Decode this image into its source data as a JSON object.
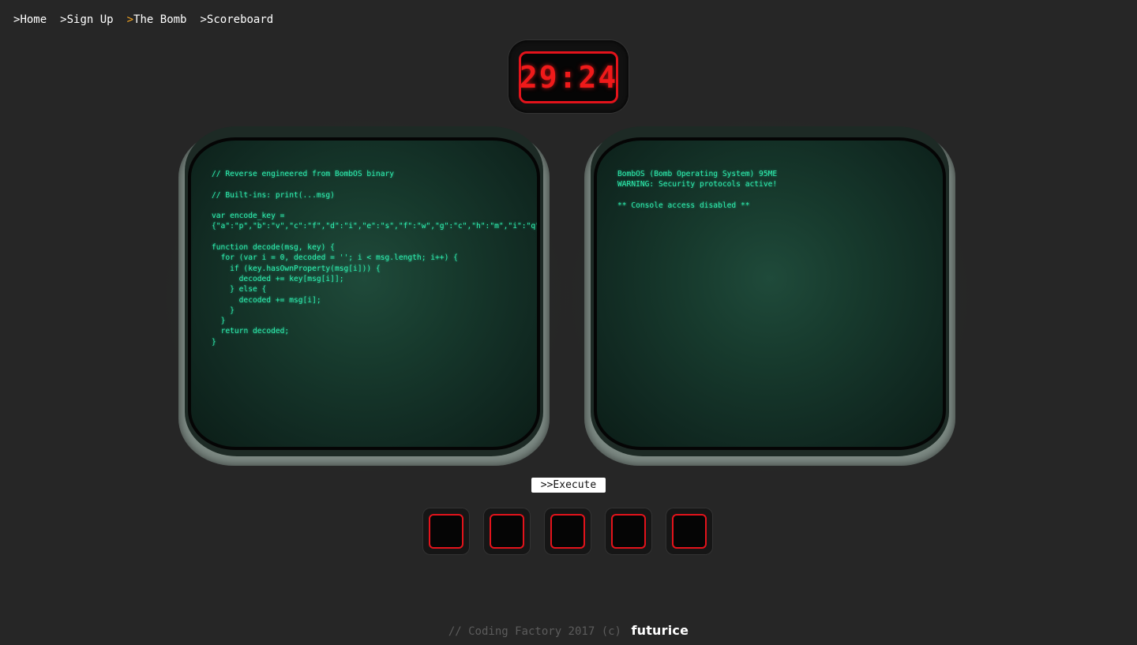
{
  "nav": {
    "items": [
      {
        "caret": ">",
        "label": "Home",
        "active": false
      },
      {
        "caret": ">",
        "label": "Sign Up",
        "active": false
      },
      {
        "caret": ">",
        "label": "The Bomb",
        "active": true
      },
      {
        "caret": ">",
        "label": "Scoreboard",
        "active": false
      }
    ]
  },
  "timer": {
    "display": "29:24"
  },
  "left_screen": {
    "code": "// Reverse engineered from BombOS binary\n\n// Built-ins: print(...msg)\n\nvar encode_key =\n{\"a\":\"p\",\"b\":\"v\",\"c\":\"f\",\"d\":\"i\",\"e\":\"s\",\"f\":\"w\",\"g\":\"c\",\"h\":\"m\",\"i\":\"q\",\"j\":\"b\",\"k\":\"a\",\"l\":\"n\",\"m\":\"l\",\"n\":\"t\",\"o\":\"r\",\"p\":\"o\",\"q\":\"x\",\"r\":\"z\",\"s\":\"y\",\"t\":\"u\",\"u\":\"e\",\"v\":\"d\",\"w\":\"j\",\"y\":\"k\",\"x\":\"h\",\"z\":\"g\"};\n\nfunction decode(msg, key) {\n  for (var i = 0, decoded = ''; i < msg.length; i++) {\n    if (key.hasOwnProperty(msg[i])) {\n      decoded += key[msg[i]];\n    } else {\n      decoded += msg[i];\n    }\n  }\n  return decoded;\n}"
  },
  "right_screen": {
    "console": "BombOS (Bomb Operating System) 95ME\nWARNING: Security protocols active!\n\n** Console access disabled **"
  },
  "execute_button": {
    "label": ">>Execute"
  },
  "slots": {
    "count": 5
  },
  "footer": {
    "text": "// Coding Factory 2017 (c)",
    "brand": "futurice"
  },
  "colors": {
    "background": "#262626",
    "accent_caret": "#f5a623",
    "terminal_text": "#2ef0b0",
    "led_red": "#e3131b"
  }
}
